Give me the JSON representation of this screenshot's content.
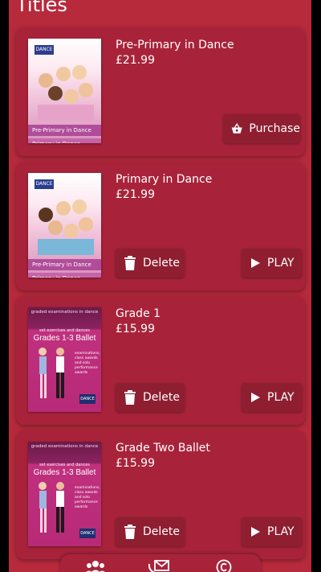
{
  "page": {
    "title": "Titles"
  },
  "items": [
    {
      "title": "Pre-Primary in Dance",
      "price": "£21.99",
      "cover": {
        "logo": "DANCE",
        "band1": "Pre-Primary in Dance",
        "band2": "Primary in Dance"
      },
      "action": {
        "label": "Purchase",
        "icon": "basket-icon"
      }
    },
    {
      "title": "Primary in Dance",
      "price": "£21.99",
      "cover": {
        "logo": "DANCE",
        "band1": "Pre-Primary in Dance",
        "band2": "Primary in Dance"
      },
      "actions": {
        "delete": "Delete",
        "play": "PLAY"
      }
    },
    {
      "title": "Grade 1",
      "price": "£15.99",
      "cover": {
        "top": "graded examinations in dance",
        "mid": "set exercises and dances",
        "big": "Grades 1-3 Ballet",
        "side": "examinations, class awards and solo performance awards",
        "logo": "DANCE"
      },
      "actions": {
        "delete": "Delete",
        "play": "PLAY"
      }
    },
    {
      "title": "Grade Two Ballet",
      "price": "£15.99",
      "cover": {
        "top": "graded examinations in dance",
        "mid": "set exercises and dances",
        "big": "Grades 1-3 Ballet",
        "side": "examinations, class awards and solo performance awards",
        "logo": "DANCE"
      },
      "actions": {
        "delete": "Delete",
        "play": "PLAY"
      }
    }
  ],
  "nav": {
    "icons": [
      "users-icon",
      "contact-icon",
      "copyright-icon"
    ]
  },
  "colors": {
    "background": "#b72a3c",
    "card": "#a8233a",
    "button": "#8f1e31",
    "text": "#ffffff"
  }
}
